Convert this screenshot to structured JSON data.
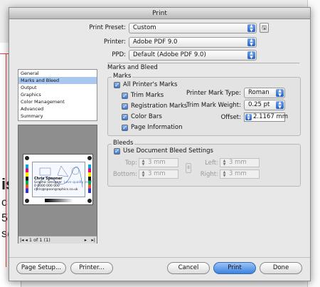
{
  "dialog": {
    "title": "Print"
  },
  "print_preset": {
    "label": "Print Preset:",
    "value": "Custom"
  },
  "printer": {
    "label": "Printer:",
    "value": "Adobe PDF 9.0"
  },
  "ppd": {
    "label": "PPD:",
    "value": "Default (Adobe PDF 9.0)"
  },
  "section_title": "Marks and Bleed",
  "categories": [
    {
      "label": "General",
      "selected": false
    },
    {
      "label": "Marks and Bleed",
      "selected": true
    },
    {
      "label": "Output",
      "selected": false
    },
    {
      "label": "Graphics",
      "selected": false
    },
    {
      "label": "Color Management",
      "selected": false
    },
    {
      "label": "Advanced",
      "selected": false
    },
    {
      "label": "Summary",
      "selected": false
    }
  ],
  "marks": {
    "group_title": "Marks",
    "all_printers_marks": "All Printer's Marks",
    "trim_marks": "Trim Marks",
    "registration_marks": "Registration Marks",
    "color_bars": "Color Bars",
    "page_information": "Page Information",
    "mark_type_label": "Printer Mark Type:",
    "mark_type_value": "Roman",
    "weight_label": "Trim Mark Weight:",
    "weight_value": "0.25 pt",
    "offset_label": "Offset:",
    "offset_value": "2.1167 mm"
  },
  "bleeds": {
    "group_title": "Bleeds",
    "use_document": "Use Document Bleed Settings",
    "top_label": "Top:",
    "bottom_label": "Bottom:",
    "left_label": "Left:",
    "right_label": "Right:",
    "top_value": "3 mm",
    "bottom_value": "3 mm",
    "left_value": "3 mm",
    "right_value": "3 mm"
  },
  "preview": {
    "name": "Chris Spooner",
    "title": "Graphic Designer",
    "phone": "0 0000 000 000",
    "email": "chris@spoongraphics.co.uk",
    "tagline": "Love quality stuff",
    "page_nav": "1 of 1 (1)"
  },
  "buttons": {
    "page_setup": "Page Setup...",
    "printer": "Printer...",
    "cancel": "Cancel",
    "print": "Print",
    "done": "Done"
  },
  "colors": {
    "accent": "#3b82e0",
    "selection": "#a9c7ef"
  }
}
